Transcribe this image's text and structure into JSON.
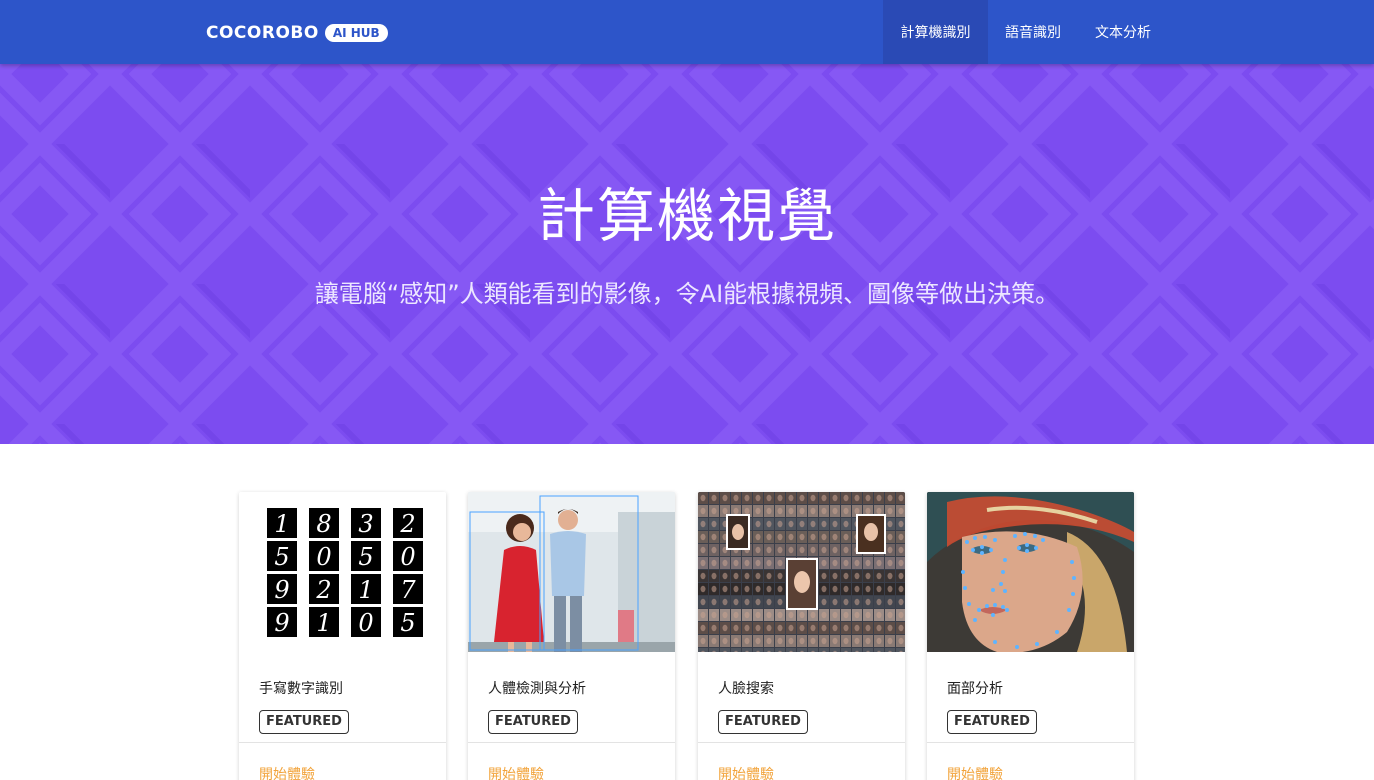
{
  "navbar": {
    "brand_name": "COCOROBO",
    "brand_badge": "AI HUB",
    "items": [
      {
        "label": "計算機識別"
      },
      {
        "label": "語音識別"
      },
      {
        "label": "文本分析"
      }
    ]
  },
  "hero": {
    "title": "計算機視覺",
    "subtitle": "讓電腦“感知”人類能看到的影像，令AI能根據視頻、圖像等做出決策。"
  },
  "cards": [
    {
      "title": "手寫數字識別",
      "badge": "FEATURED",
      "action": "開始體驗",
      "digits": [
        "1",
        "8",
        "3",
        "2",
        "5",
        "0",
        "5",
        "0",
        "9",
        "2",
        "1",
        "7",
        "9",
        "1",
        "0",
        "5"
      ]
    },
    {
      "title": "人體檢測與分析",
      "badge": "FEATURED",
      "action": "開始體驗"
    },
    {
      "title": "人臉搜索",
      "badge": "FEATURED",
      "action": "開始體驗"
    },
    {
      "title": "面部分析",
      "badge": "FEATURED",
      "action": "開始體驗"
    }
  ],
  "colors": {
    "navbar": "#2d55c9",
    "hero": "#7c4cf0",
    "action": "#f2a33a"
  }
}
